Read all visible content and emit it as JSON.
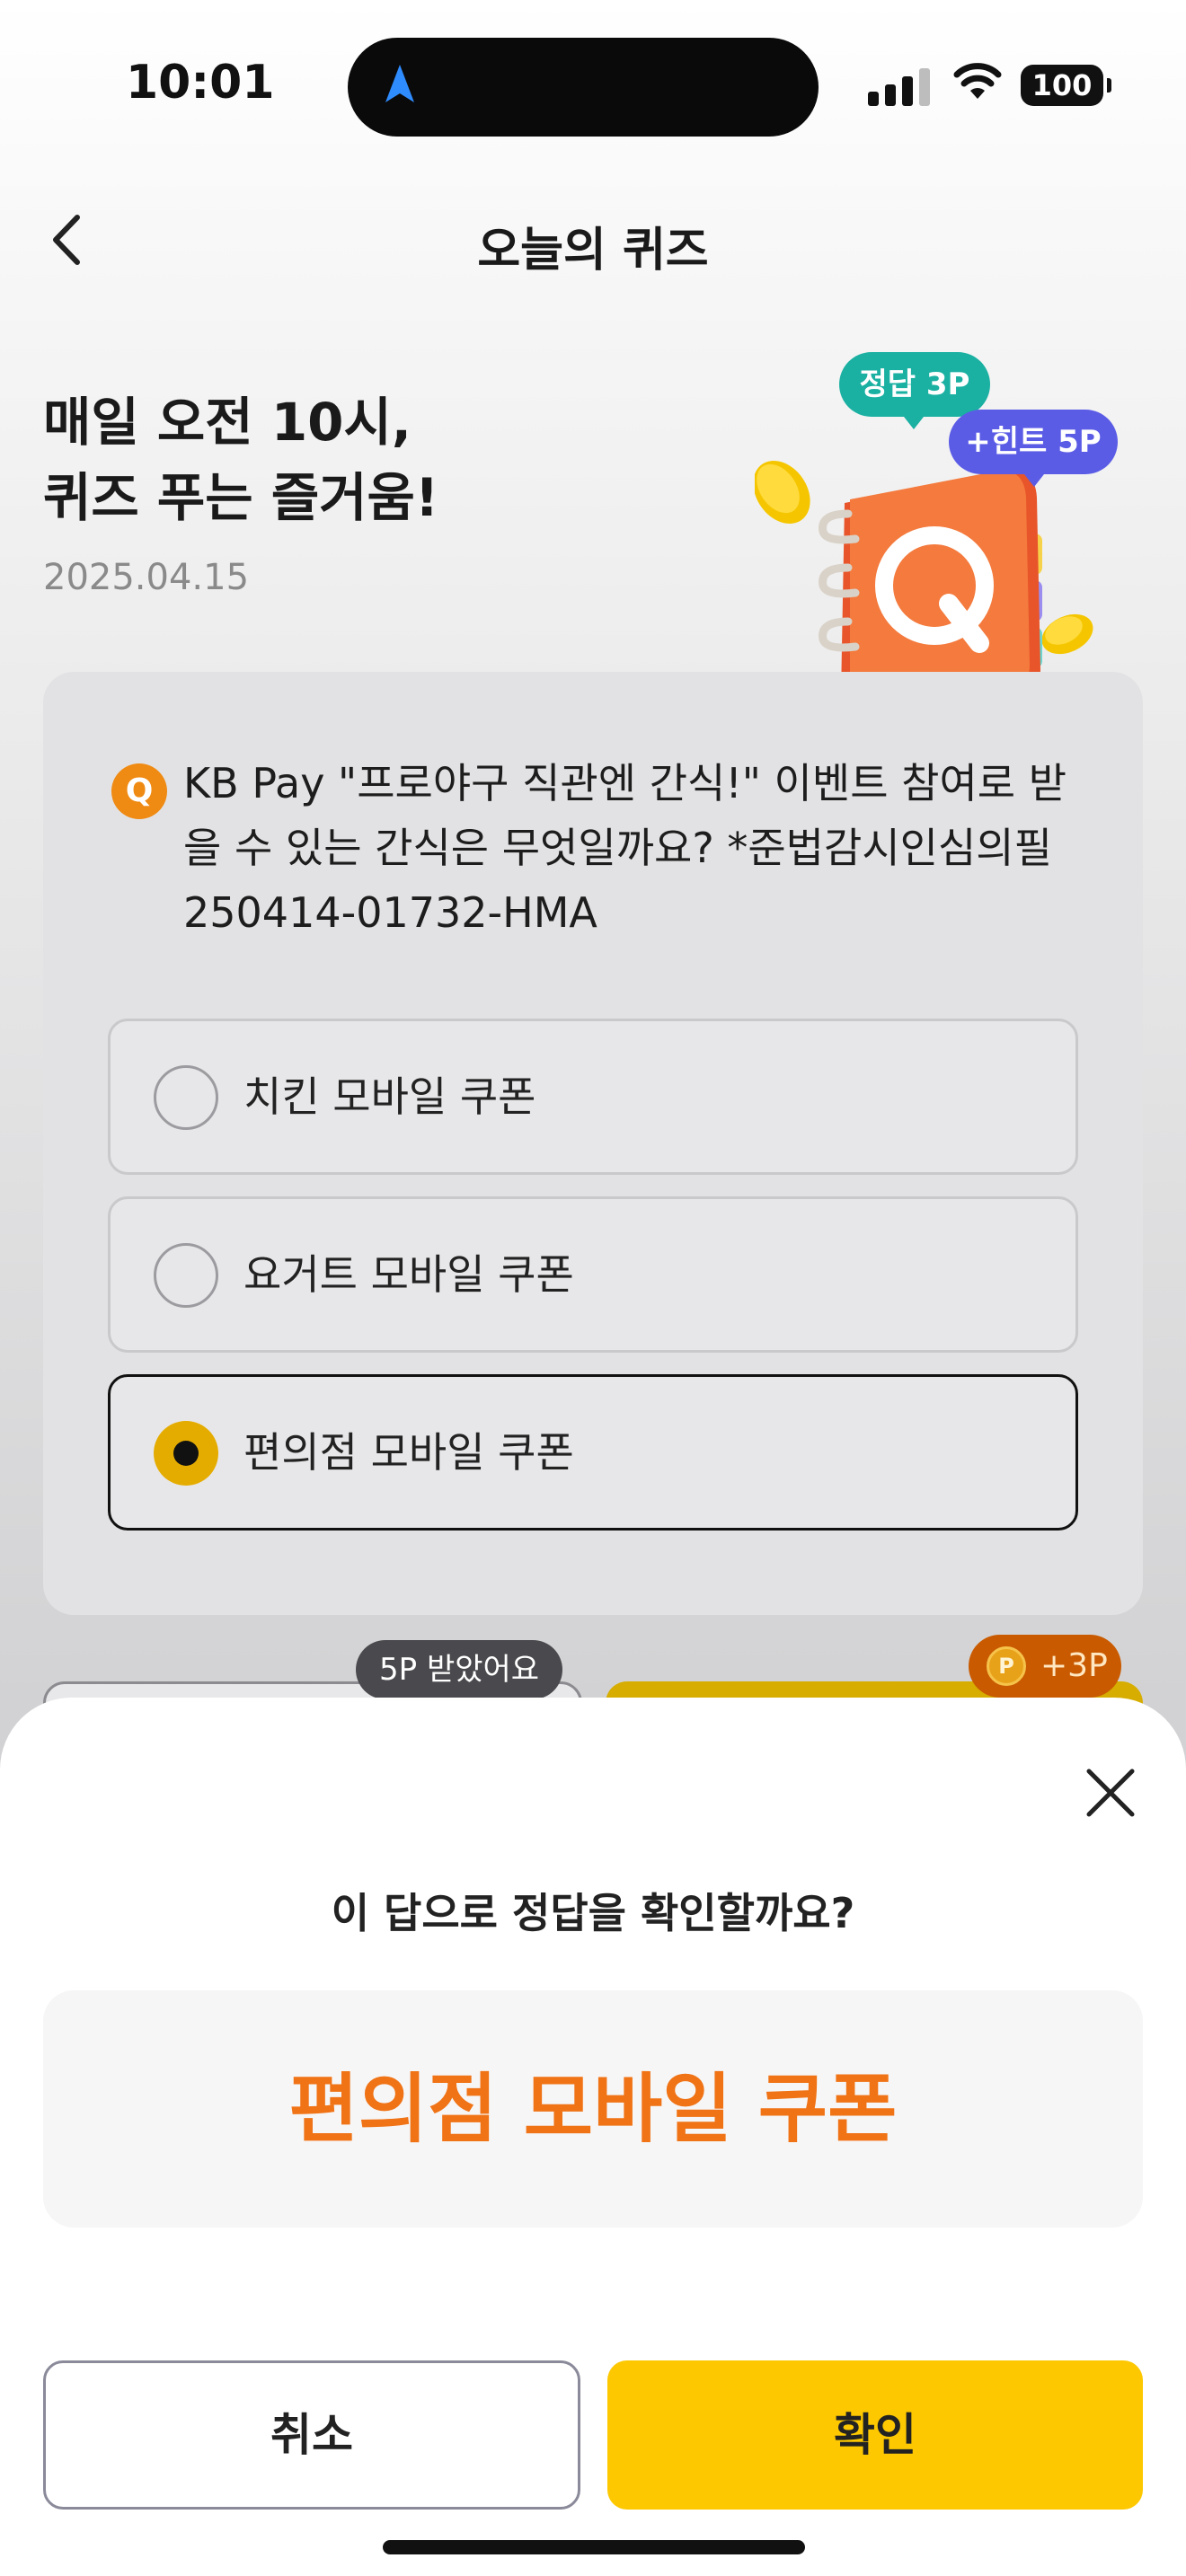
{
  "status_bar": {
    "time": "10:01",
    "battery": "100"
  },
  "header": {
    "title": "오늘의 퀴즈"
  },
  "hero": {
    "title_lines": [
      "매일 오전 10시,",
      "퀴즈 푸는 즐거움!"
    ],
    "date": "2025.04.15",
    "bubble_answer": "정답 3P",
    "bubble_hint": "+힌트 5P",
    "illustration_letter": "Q"
  },
  "quiz": {
    "badge": "Q",
    "question_lines": [
      "KB Pay \"프로야구 직관엔 간식!\" 이벤트 참여로 받",
      "을 수 있는 간식은 무엇일까요? *준법감시인심의필",
      "250414-01732-HMA"
    ],
    "options": [
      {
        "label": "치킨 모바일 쿠폰",
        "selected": false
      },
      {
        "label": "요거트 모바일 쿠폰",
        "selected": false
      },
      {
        "label": "편의점 모바일 쿠폰",
        "selected": true
      }
    ],
    "hint_badge": "5P 받았어요",
    "point_badge": {
      "coin": "P",
      "points": "+3P"
    }
  },
  "sheet": {
    "question": "이 답으로 정답을 확인할까요?",
    "selected_answer": "편의점 모바일 쿠폰",
    "cancel_label": "취소",
    "confirm_label": "확인"
  },
  "colors": {
    "accent_orange": "#f07315",
    "confirm_yellow": "#fdc800",
    "teal_bubble": "#1ab0a2",
    "purple_bubble": "#5b5ce6"
  },
  "icons": [
    "location-arrow-icon",
    "signal-icon",
    "wifi-icon",
    "battery-icon",
    "back-chevron-icon",
    "close-icon",
    "point-coin-icon"
  ]
}
